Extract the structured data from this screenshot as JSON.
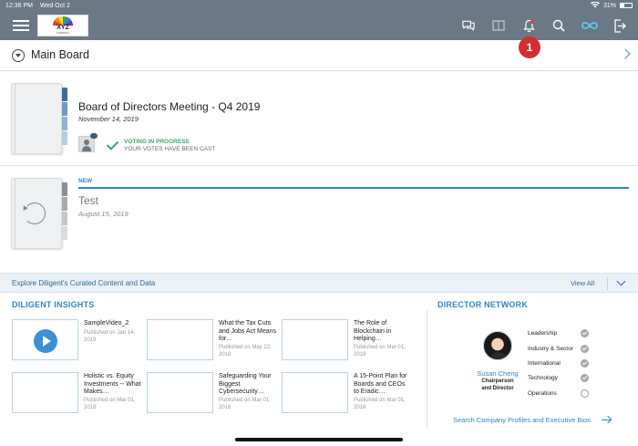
{
  "status_bar": {
    "time": "12:36 PM",
    "date": "Wed Oct 2",
    "battery": "31%"
  },
  "nav": {
    "logo_text": "XYZ",
    "logo_subtext": "COMPANY",
    "icons": [
      "menu-icon",
      "chat-icon",
      "book-icon",
      "bell-icon",
      "search-icon",
      "infinity-icon",
      "logout-icon"
    ],
    "notification_badge": "1",
    "accent_color": "#3a8fd8",
    "bar_color": "#6b7886"
  },
  "board": {
    "title": "Main Board"
  },
  "meetings": [
    {
      "title": "Board of Directors Meeting - Q4 2019",
      "date": "November 14, 2019",
      "status": "VOTING IN PROGRESS",
      "status_sub": "YOUR VOTES HAVE BEEN CAST"
    },
    {
      "label": "NEW",
      "title": "Test",
      "date": "August 15, 2019"
    }
  ],
  "explore": {
    "title": "Explore Diligent's Curated Content and Data",
    "view_all": "View All"
  },
  "insights": {
    "title": "DILIGENT INSIGHTS",
    "items": [
      {
        "title": "SampleVideo_2",
        "date": "Published on Jan 14, 2019"
      },
      {
        "title": "What the Tax Cuts and Jobs Act Means for…",
        "date": "Published on May 22, 2018"
      },
      {
        "title": "The Role of Blockchain in Helping…",
        "date": "Published on Mar 01, 2018"
      },
      {
        "title": "Holistic vs. Equity Investments -- What Makes…",
        "date": "Published on Mar 01, 2018"
      },
      {
        "title": "Safeguarding Your Biggest Cybersecurity…",
        "date": "Published on Mar 01, 2018"
      },
      {
        "title": "A 15-Point Plan for Boards and CEOs to Eradic…",
        "date": "Published on Mar 01, 2018"
      }
    ]
  },
  "director_network": {
    "title": "DIRECTOR NETWORK",
    "name": "Susan Cheng",
    "role_line1": "Chairperson",
    "role_line2": "and Director",
    "roles": [
      {
        "label": "Leadership",
        "checked": true
      },
      {
        "label": "Industry & Sector",
        "checked": true
      },
      {
        "label": "International",
        "checked": true
      },
      {
        "label": "Technology",
        "checked": true
      },
      {
        "label": "Operations",
        "checked": false
      }
    ],
    "search_link": "Search Company Profiles and Executive Bios"
  }
}
